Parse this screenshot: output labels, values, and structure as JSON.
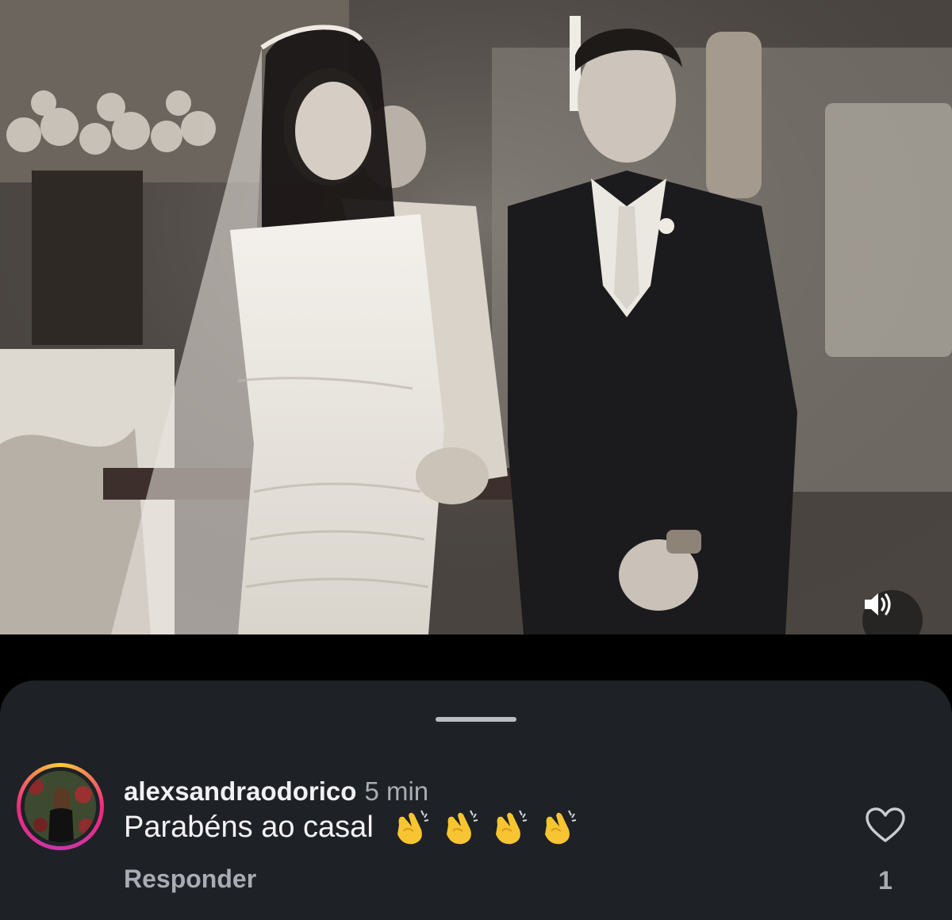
{
  "media": {
    "audio_icon": "speaker-icon"
  },
  "comment": {
    "username": "alexsandraodorico",
    "time": "5 min",
    "text": "Parabéns ao casal",
    "emojis": [
      "👏",
      "👏",
      "👏",
      "👏"
    ],
    "reply_label": "Responder",
    "like_icon": "heart-icon",
    "like_count": "1"
  },
  "colors": {
    "sheet_background": "#1e2126",
    "username": "#f1f1f3",
    "muted_text": "#a8acb3",
    "avatar_ring": [
      "#f9ce34",
      "#ee2a7b",
      "#c837ab"
    ]
  }
}
